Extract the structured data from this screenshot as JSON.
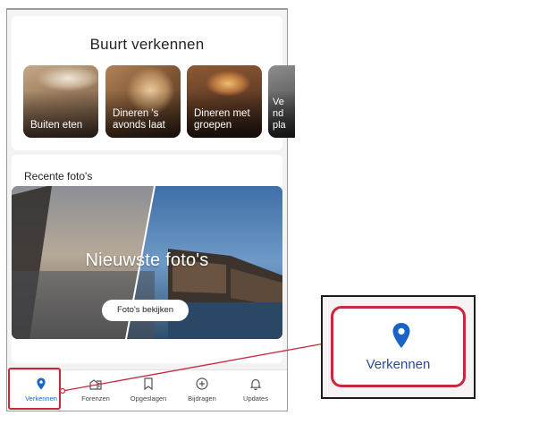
{
  "nearby": {
    "title": "Buurt verkennen",
    "tiles": [
      {
        "label": "Buiten eten"
      },
      {
        "label": "Dineren 's avonds laat"
      },
      {
        "label": "Dineren met groepen"
      },
      {
        "label": "Ve nd pla"
      }
    ]
  },
  "photos": {
    "section_title": "Recente foto's",
    "hero_title": "Nieuwste foto's",
    "button_label": "Foto's bekijken"
  },
  "nav": {
    "items": [
      {
        "label": "Verkennen",
        "icon": "location-pin-icon",
        "active": true
      },
      {
        "label": "Forenzen",
        "icon": "commute-icon",
        "active": false
      },
      {
        "label": "Opgeslagen",
        "icon": "bookmark-icon",
        "active": false
      },
      {
        "label": "Bijdragen",
        "icon": "add-circle-icon",
        "active": false
      },
      {
        "label": "Updates",
        "icon": "bell-icon",
        "active": false
      }
    ]
  },
  "callout": {
    "label": "Verkennen",
    "icon": "location-pin-icon"
  },
  "colors": {
    "accent_blue": "#1a64c7",
    "highlight_red": "#c8283a",
    "callout_text": "#2b4a9c"
  }
}
